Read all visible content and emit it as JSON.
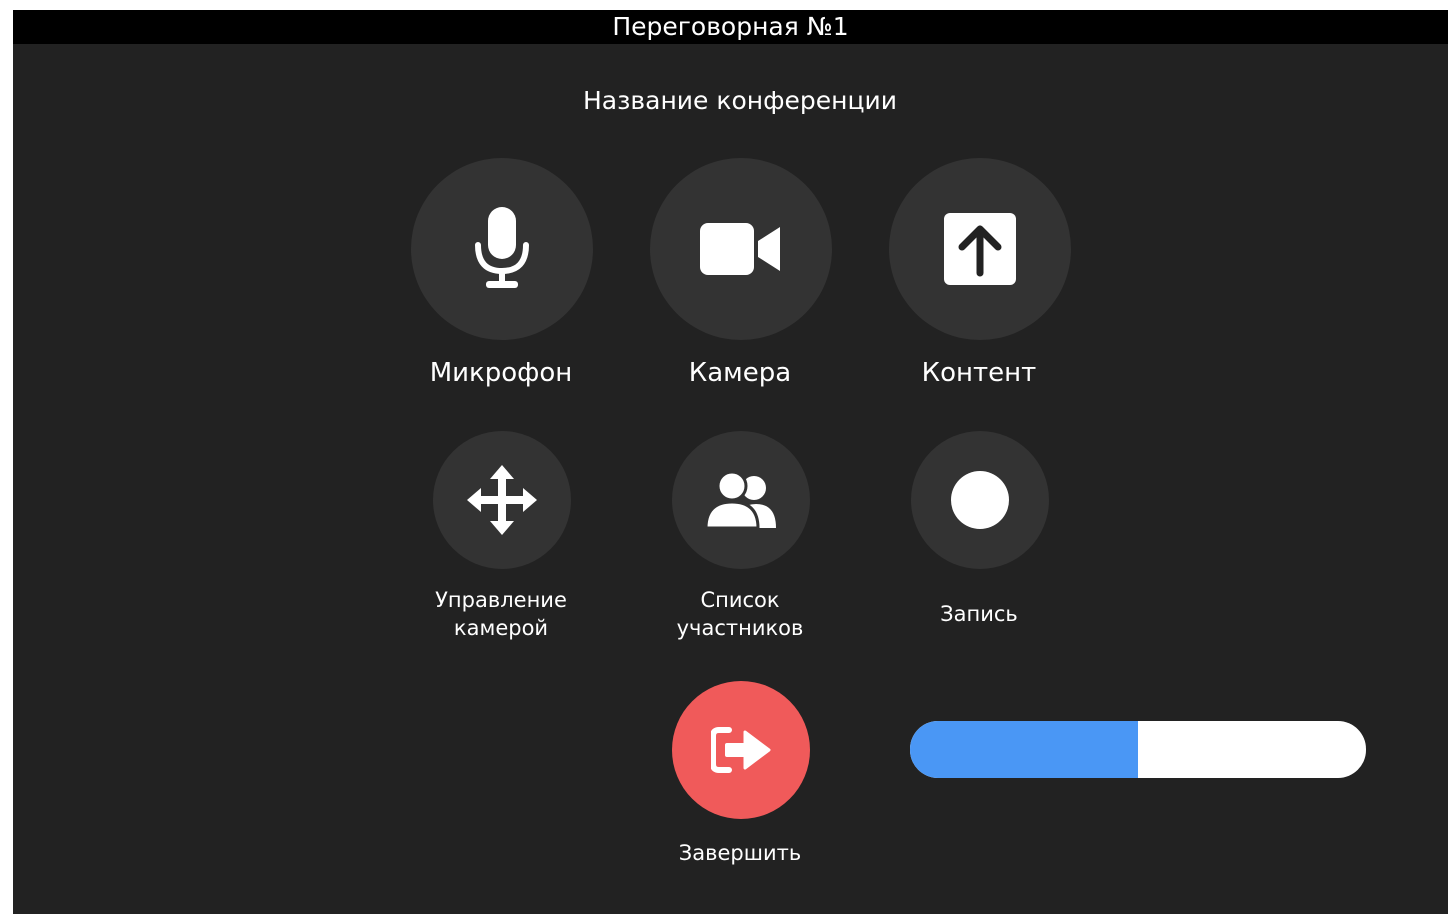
{
  "titlebar": {
    "title": "Переговорная №1"
  },
  "conference": {
    "title": "Название конференции"
  },
  "buttons": {
    "microphone": {
      "label": "Микрофон",
      "icon": "microphone-icon"
    },
    "camera": {
      "label": "Камера",
      "icon": "video-camera-icon"
    },
    "content": {
      "label": "Контент",
      "icon": "share-content-icon"
    },
    "camera_control": {
      "label_line1": "Управление",
      "label_line2": "камерой",
      "icon": "move-arrows-icon"
    },
    "participants": {
      "label_line1": "Список",
      "label_line2": "участников",
      "icon": "users-icon"
    },
    "record": {
      "label": "Запись",
      "icon": "record-icon"
    },
    "end": {
      "label": "Завершить",
      "icon": "sign-out-icon"
    }
  },
  "volume": {
    "fraction": 0.5
  },
  "colors": {
    "background": "#222222",
    "button": "#333333",
    "end_button": "#f05a5a",
    "progress_fill": "#4a97f5",
    "progress_track": "#ffffff"
  }
}
